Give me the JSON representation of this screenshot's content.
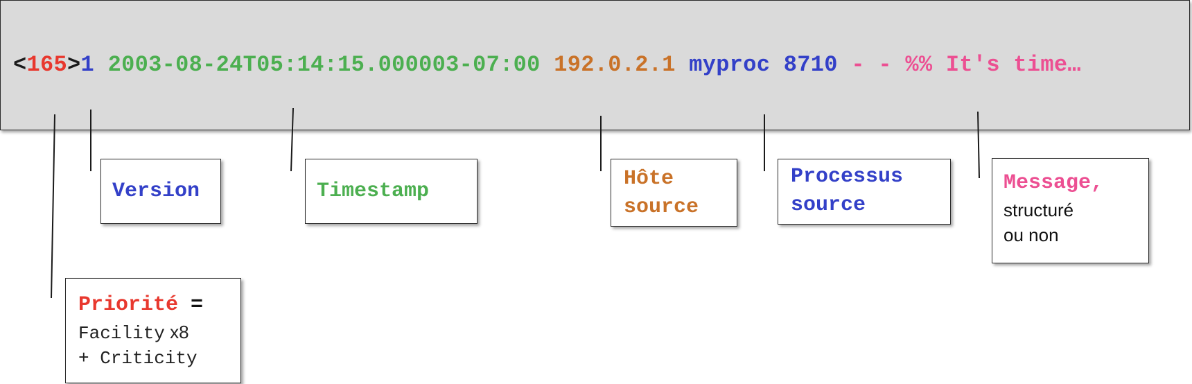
{
  "colors": {
    "black": "#1a1a1a",
    "red": "#e8382e",
    "blue": "#3340c8",
    "green": "#4caf50",
    "orange": "#c97228",
    "pink": "#ec4f92"
  },
  "log_line": {
    "lt": "<",
    "priority": "165",
    "gt": ">",
    "version": "1",
    "timestamp": "2003-08-24T05:14:15.000003-07:00",
    "host": "192.0.2.1",
    "process": "myproc 8710",
    "dashes": "- -",
    "message": "%% It's time…"
  },
  "labels": {
    "version": "Version",
    "timestamp": "Timestamp",
    "host_line1": "Hôte",
    "host_line2": "source",
    "process_line1": "Processus",
    "process_line2": "source",
    "message_title": "Message,",
    "message_line1": "structuré",
    "message_line2": "ou non",
    "priority_title": "Priorité",
    "priority_eq": "=",
    "priority_facility": "Facility",
    "priority_x8": "x8",
    "priority_criticity": "+ Criticity"
  }
}
